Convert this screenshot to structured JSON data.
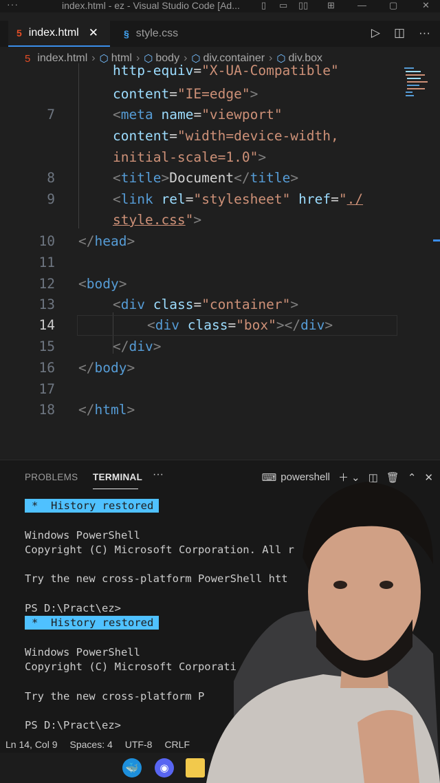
{
  "window": {
    "title": "index.html - ez - Visual Studio Code [Ad..."
  },
  "tabs": [
    {
      "label": "index.html",
      "icon": "html5-icon",
      "active": true
    },
    {
      "label": "style.css",
      "icon": "css-icon",
      "active": false
    }
  ],
  "breadcrumb": [
    "index.html",
    "html",
    "body",
    "div.container",
    "div.box"
  ],
  "code": {
    "wrapped_top_1": "http-equiv=\"X-UA-Compatible\"",
    "wrapped_top_2": "content=\"IE=edge\">",
    "lines": [
      {
        "n": "7"
      },
      {
        "n": "8"
      },
      {
        "n": "9"
      },
      {
        "n": "10"
      },
      {
        "n": "11"
      },
      {
        "n": "12"
      },
      {
        "n": "13"
      },
      {
        "n": "14"
      },
      {
        "n": "15"
      },
      {
        "n": "16"
      },
      {
        "n": "17"
      },
      {
        "n": "18"
      }
    ]
  },
  "panel": {
    "tabs": [
      "PROBLEMS",
      "TERMINAL"
    ],
    "shell": "powershell",
    "terminal": {
      "badge": "History restored",
      "badge_star": "*",
      "l1": "Windows PowerShell",
      "l2": "Copyright (C) Microsoft Corporation. All r",
      "l3": "Try the new cross-platform PowerShell htt",
      "prompt": "PS D:\\Pract\\ez>",
      "l4": "Windows PowerShell",
      "l5": "Copyright (C) Microsoft Corporati",
      "l6": "Try the new cross-platform P"
    }
  },
  "status": {
    "position": "Ln 14, Col 9",
    "spaces": "Spaces: 4",
    "encoding": "UTF-8",
    "eol": "CRLF"
  },
  "colors": {
    "accent": "#3b8eea",
    "badge": "#4fc1ff",
    "tag": "#569cd6",
    "attr": "#9cdcfe",
    "string": "#ce9178"
  }
}
